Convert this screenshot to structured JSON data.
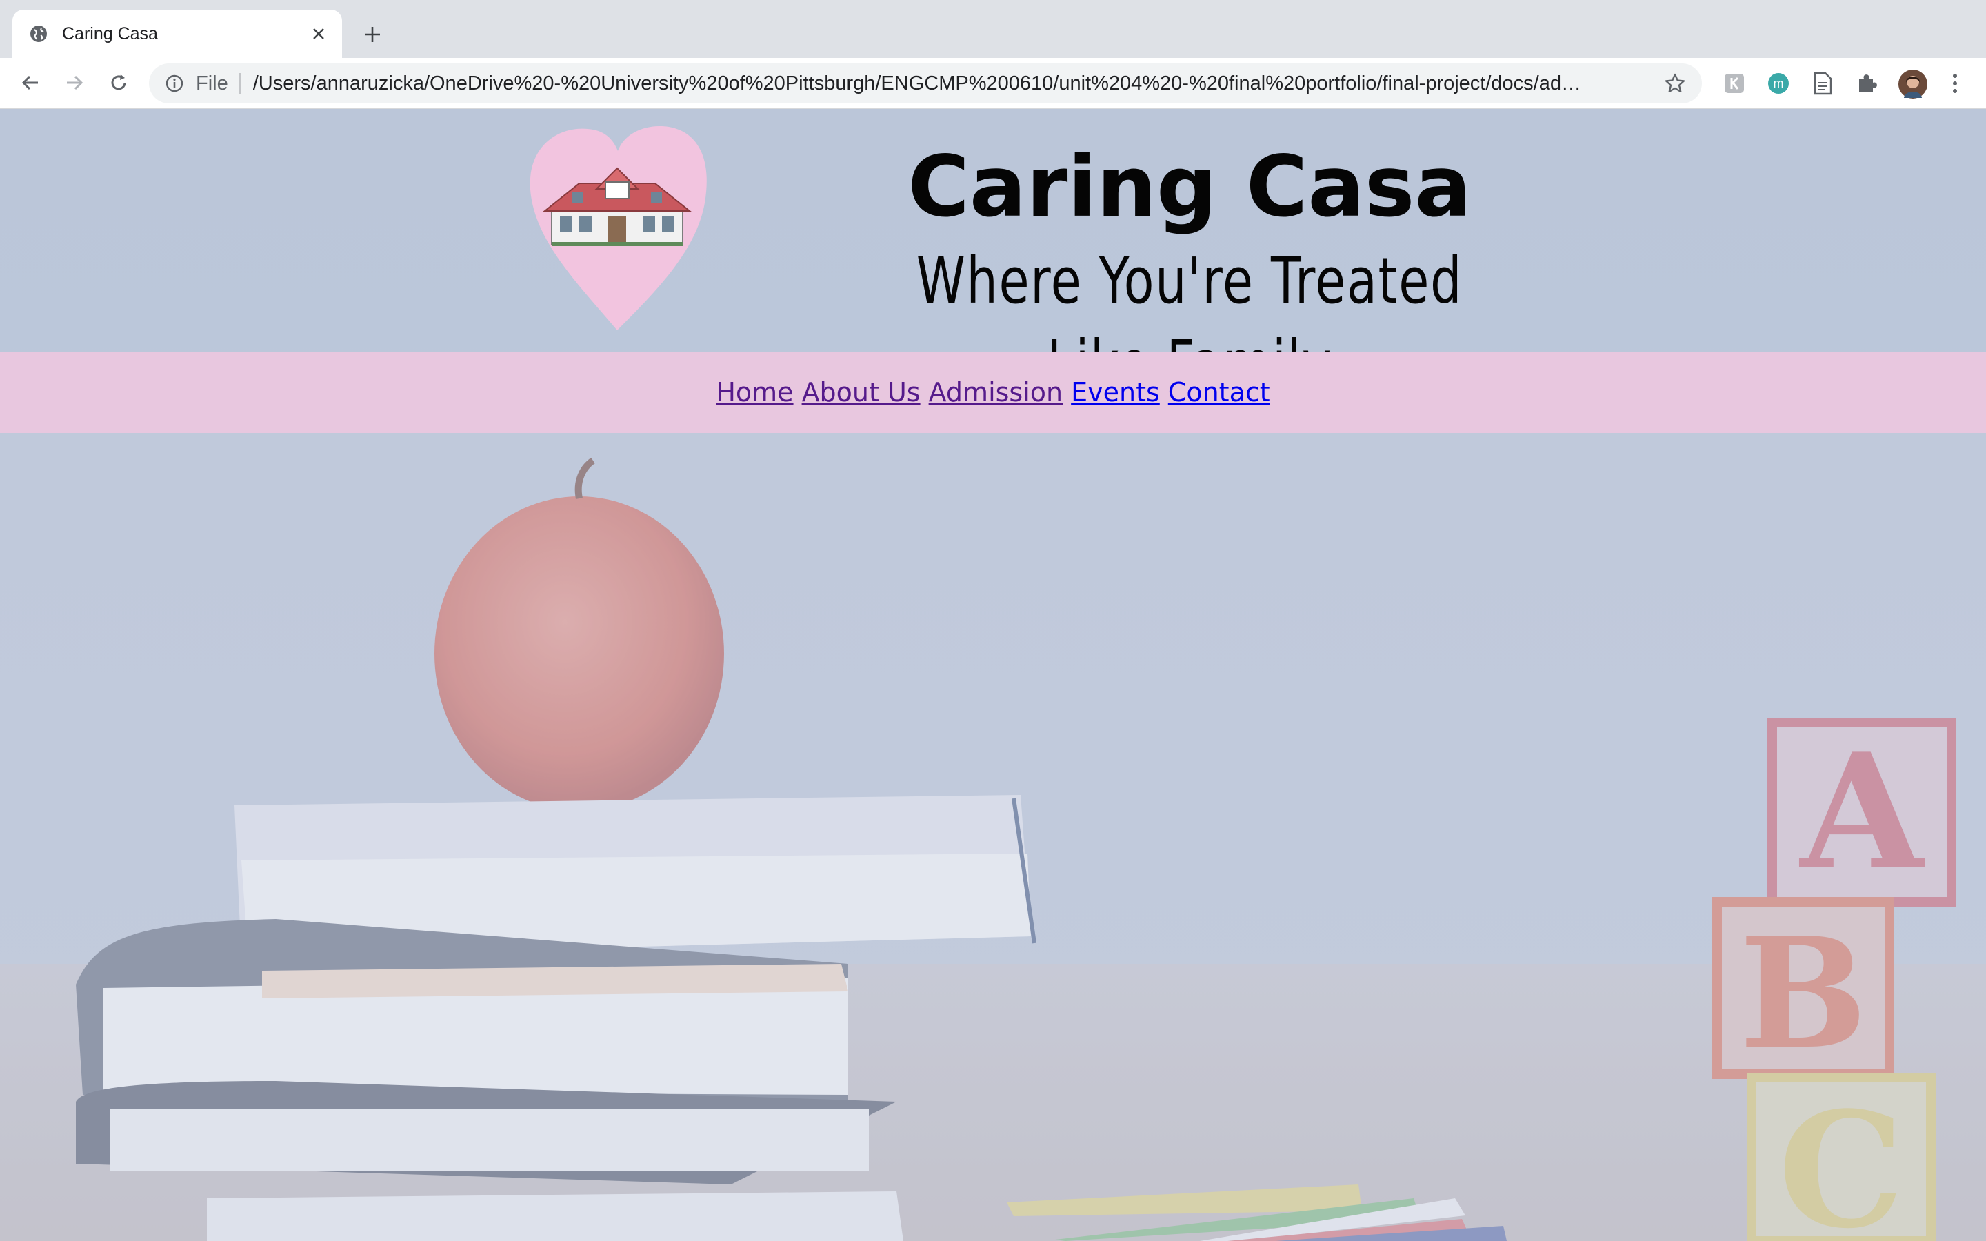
{
  "browser": {
    "tab_title": "Caring Casa",
    "omnibox_scheme_label": "File",
    "url": "/Users/annaruzicka/OneDrive%20-%20University%20of%20Pittsburgh/ENGCMP%200610/unit%204%20-%20final%20portfolio/final-project/docs/admissio...",
    "extension_badge_letter": "m"
  },
  "site": {
    "title": "Caring Casa",
    "tagline": "Where You're Treated Like Family",
    "nav": [
      {
        "label": "Home",
        "state": "visited"
      },
      {
        "label": "About Us",
        "state": "visited"
      },
      {
        "label": "Admission",
        "state": "visited"
      },
      {
        "label": "Events",
        "state": "unvisited"
      },
      {
        "label": "Contact",
        "state": "unvisited"
      }
    ]
  },
  "colors": {
    "nav_background": "#e8c7df",
    "header_background": "#b8c4d8",
    "logo_heart": "#f2c4df",
    "visited_link": "#551a8b",
    "unvisited_link": "#0000ee"
  }
}
